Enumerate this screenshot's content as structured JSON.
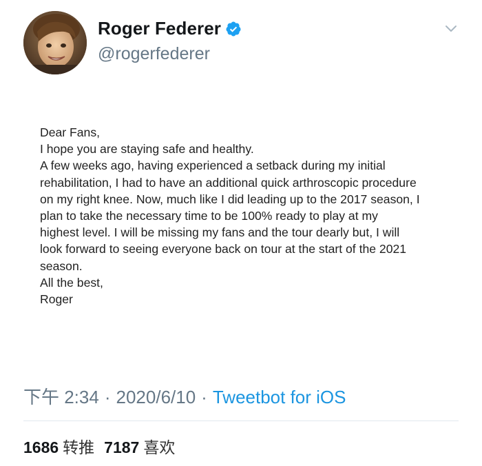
{
  "profile": {
    "display_name": "Roger Federer",
    "handle": "@rogerfederer",
    "verified_icon": "verified-badge-icon",
    "menu_icon": "chevron-down-icon"
  },
  "letter": {
    "lines": [
      "Dear Fans,",
      "I hope you are staying safe and healthy.",
      "A few weeks ago, having experienced a setback during my initial",
      "rehabilitation, I had to have an additional quick arthroscopic procedure",
      "on my right knee. Now, much like I did leading up to the 2017 season, I",
      "plan to take the necessary time to be 100% ready to play at my",
      "highest level. I will be missing my fans and the tour dearly but, I will",
      "look forward to seeing everyone back on tour at the start of the 2021",
      "season.",
      "All the best,",
      "Roger"
    ]
  },
  "meta": {
    "time": "下午 2:34",
    "separator": "·",
    "date": "2020/6/10",
    "source": "Tweetbot for iOS"
  },
  "stats": {
    "retweets_count": "1686",
    "retweets_label": "转推",
    "likes_count": "7187",
    "likes_label": "喜欢"
  },
  "colors": {
    "link": "#1b95e0",
    "secondary_text": "#657786",
    "verified": "#1da1f2"
  }
}
